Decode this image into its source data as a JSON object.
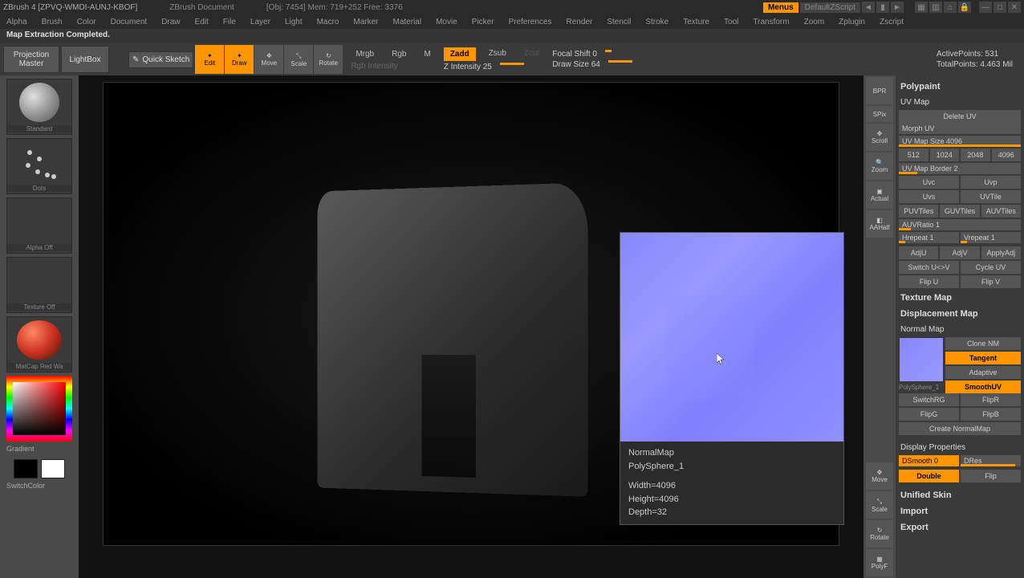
{
  "titlebar": {
    "app": "ZBrush 4 [ZPVQ-WMDI-AUNJ-KBOF]",
    "document": "ZBrush Document",
    "objinfo": "[Obj: 7454]  Mem: 719+252  Free: 3376",
    "menus": "Menus",
    "script": "DefaultZScript"
  },
  "menubar": {
    "items": [
      "Alpha",
      "Brush",
      "Color",
      "Document",
      "Draw",
      "Edit",
      "File",
      "Layer",
      "Light",
      "Macro",
      "Marker",
      "Material",
      "Movie",
      "Picker",
      "Preferences",
      "Render",
      "Stencil",
      "Stroke",
      "Texture",
      "Tool",
      "Transform",
      "Zoom",
      "Zplugin",
      "Zscript"
    ]
  },
  "status": "Map Extraction Completed.",
  "toolbar": {
    "projection": "Projection Master",
    "lightbox": "LightBox",
    "quicksketch": "Quick Sketch",
    "edit": "Edit",
    "draw": "Draw",
    "move": "Move",
    "scale": "Scale",
    "rotate": "Rotate",
    "mrgb": "Mrgb",
    "rgb": "Rgb",
    "m": "M",
    "rgbintensity": "Rgb Intensity",
    "zadd": "Zadd",
    "zsub": "Zsub",
    "zcut": "Zcut",
    "zintensity": "Z Intensity 25",
    "focalshift": "Focal Shift 0",
    "drawsize": "Draw Size 64",
    "activepoints": "ActivePoints: 531",
    "totalpoints": "TotalPoints: 4.463 Mil"
  },
  "left": {
    "standard": "Standard",
    "dots": "Dots",
    "alphaoff": "Alpha Off",
    "textureoff": "Texture Off",
    "material": "MatCap Red Wa",
    "gradient": "Gradient",
    "switchcolor": "SwitchColor"
  },
  "rightv": {
    "bpr": "BPR",
    "spix": "SPix",
    "scroll": "Scroll",
    "zoom": "Zoom",
    "actual": "Actual",
    "aahalf": "AAHalf",
    "move": "Move",
    "scale": "Scale",
    "rotate": "Rotate",
    "polyf": "PolyF"
  },
  "preview": {
    "name": "NormalMap",
    "subtool": "PolySphere_1",
    "width": "Width=4096",
    "height": "Height=4096",
    "depth": "Depth=32"
  },
  "panel": {
    "polypaint": "Polypaint",
    "uvmap": "UV Map",
    "deleteuv": "Delete UV",
    "morphuv": "Morph UV",
    "uvmapsize": "UV Map Size 4096",
    "s512": "512",
    "s1024": "1024",
    "s2048": "2048",
    "s4096": "4096",
    "uvborder": "UV Map Border 2",
    "uvc": "Uvc",
    "uvp": "Uvp",
    "uvs": "Uvs",
    "uvtile": "UVTile",
    "puv": "PUVTiles",
    "guv": "GUVTiles",
    "auv": "AUVTiles",
    "auvratio": "AUVRatio 1",
    "hrepeat": "Hrepeat 1",
    "vrepeat": "Vrepeat 1",
    "adju": "AdjU",
    "adjv": "AdjV",
    "applyadj": "ApplyAdj",
    "switchuv": "Switch U<>V",
    "cycleuv": "Cycle UV",
    "flipu": "Flip U",
    "flipv": "Flip V",
    "texturemap": "Texture Map",
    "dispmap": "Displacement Map",
    "normalmap": "Normal Map",
    "clonenm": "Clone NM",
    "tangent": "Tangent",
    "adaptive": "Adaptive",
    "smoothuv": "SmoothUV",
    "polysphere": "PolySphere_1",
    "switchrg": "SwitchRG",
    "flipr": "FlipR",
    "flipg": "FlipG",
    "flipb": "FlipB",
    "createnm": "Create NormalMap",
    "dispprops": "Display Properties",
    "dsmooth": "DSmooth 0",
    "dres": "DRes",
    "double": "Double",
    "flip": "Flip",
    "unifiedskin": "Unified Skin",
    "import": "Import",
    "export": "Export"
  }
}
